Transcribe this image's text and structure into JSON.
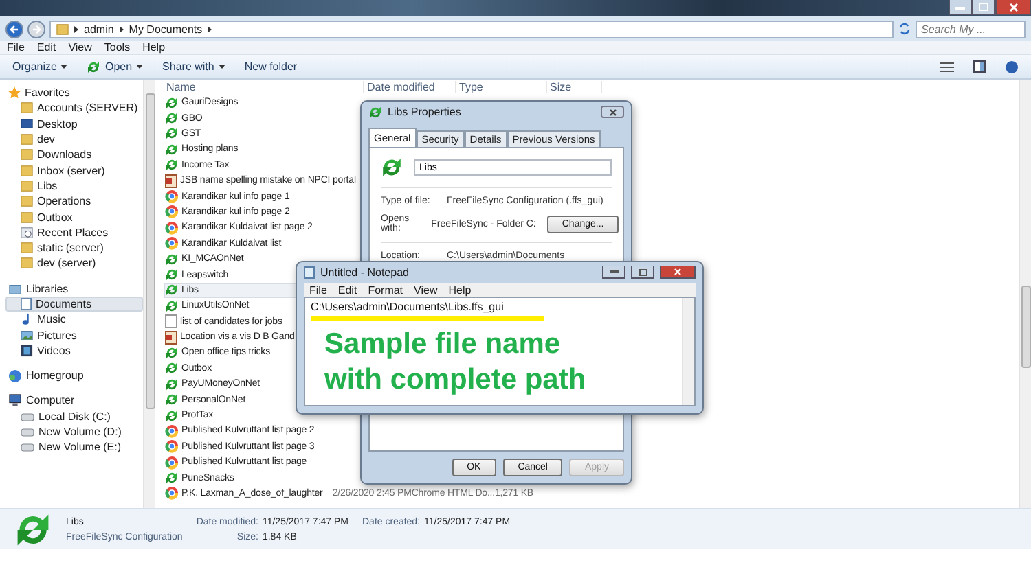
{
  "address_bar": {
    "breadcrumbs": [
      "admin",
      "My Documents"
    ],
    "search": {
      "placeholder": "Search My ..."
    }
  },
  "menu_bar": [
    "File",
    "Edit",
    "View",
    "Tools",
    "Help"
  ],
  "toolbar": [
    {
      "label": "Organize",
      "kind": "menu"
    },
    {
      "label": "Open",
      "kind": "open"
    },
    {
      "label": "Share with",
      "kind": "menu"
    },
    {
      "label": "New folder",
      "kind": "plain"
    }
  ],
  "sidebar": [
    {
      "label": "Favorites",
      "kind": "star",
      "children": [
        {
          "label": "Accounts (SERVER)",
          "kind": "folder",
          "selected": false
        },
        {
          "label": "Desktop",
          "kind": "desktop",
          "selected": false
        },
        {
          "label": "dev",
          "kind": "folder",
          "selected": false
        },
        {
          "label": "Downloads",
          "kind": "folder",
          "selected": false
        },
        {
          "label": "Inbox (server)",
          "kind": "folder",
          "selected": false
        },
        {
          "label": "Libs",
          "kind": "folder",
          "selected": false
        },
        {
          "label": "Operations",
          "kind": "folder",
          "selected": false
        },
        {
          "label": "Outbox",
          "kind": "folder",
          "selected": false
        },
        {
          "label": "Recent Places",
          "kind": "recent",
          "selected": false
        },
        {
          "label": "static (server)",
          "kind": "folder",
          "selected": false
        },
        {
          "label": "dev (server)",
          "kind": "folder",
          "selected": false
        }
      ]
    },
    {
      "label": "Libraries",
      "kind": "library",
      "children": [
        {
          "label": "Documents",
          "kind": "document",
          "selected": true
        },
        {
          "label": "Music",
          "kind": "music",
          "selected": false
        },
        {
          "label": "Pictures",
          "kind": "pictures",
          "selected": false
        },
        {
          "label": "Videos",
          "kind": "videos",
          "selected": false
        }
      ]
    },
    {
      "label": "Homegroup",
      "kind": "homegroup"
    },
    {
      "label": "Computer",
      "kind": "computer",
      "children": [
        {
          "label": "Local Disk (C:)",
          "kind": "drive",
          "selected": false
        },
        {
          "label": "New Volume (D:)",
          "kind": "drive",
          "selected": false
        },
        {
          "label": "New Volume (E:)",
          "kind": "drive",
          "selected": false
        }
      ]
    }
  ],
  "file_list": {
    "columns": [
      "Name",
      "Date modified",
      "Type",
      "Size"
    ],
    "rows": [
      {
        "name": "GauriDesigns",
        "kind": "sync",
        "selected": false
      },
      {
        "name": "GBO",
        "kind": "sync",
        "selected": false
      },
      {
        "name": "GST",
        "kind": "sync",
        "selected": false
      },
      {
        "name": "Hosting plans",
        "kind": "sync",
        "selected": false
      },
      {
        "name": "Income Tax",
        "kind": "sync",
        "selected": false
      },
      {
        "name": "JSB name spelling mistake on NPCI portal",
        "kind": "pdf",
        "selected": false
      },
      {
        "name": "Karandikar kul info page 1",
        "kind": "web",
        "selected": false
      },
      {
        "name": "Karandikar kul info page 2",
        "kind": "web",
        "selected": false
      },
      {
        "name": "Karandikar Kuldaivat list page 2",
        "kind": "web",
        "selected": false
      },
      {
        "name": "Karandikar Kuldaivat list",
        "kind": "web",
        "selected": false
      },
      {
        "name": "KI_MCAOnNet",
        "kind": "sync",
        "selected": false
      },
      {
        "name": "Leapswitch",
        "kind": "sync",
        "selected": false
      },
      {
        "name": "Libs",
        "kind": "sync",
        "selected": true
      },
      {
        "name": "LinuxUtilsOnNet",
        "kind": "sync",
        "selected": false
      },
      {
        "name": "list of candidates for jobs",
        "kind": "text",
        "selected": false
      },
      {
        "name": "Location vis a vis D B Gand",
        "kind": "pdf",
        "selected": false
      },
      {
        "name": "Open office tips tricks",
        "kind": "sync",
        "selected": false
      },
      {
        "name": "Outbox",
        "kind": "sync",
        "selected": false
      },
      {
        "name": "PayUMoneyOnNet",
        "kind": "sync",
        "selected": false
      },
      {
        "name": "PersonalOnNet",
        "kind": "sync",
        "selected": false
      },
      {
        "name": "ProfTax",
        "kind": "sync",
        "selected": false
      },
      {
        "name": "Published Kulvruttant list page 2",
        "kind": "web",
        "selected": false
      },
      {
        "name": "Published Kulvruttant list page 3",
        "kind": "web",
        "selected": false
      },
      {
        "name": "Published Kulvruttant list page",
        "kind": "web",
        "selected": false
      },
      {
        "name": "PuneSnacks",
        "kind": "sync",
        "selected": false
      },
      {
        "name": "P.K. Laxman_A_dose_of_laughter",
        "kind": "web",
        "selected": false,
        "date": "2/26/2020 2:45 PM",
        "type": "Chrome HTML Do...",
        "size": "1,271 KB"
      }
    ]
  },
  "details_pane": {
    "name": "Libs",
    "type": "FreeFileSync Configuration",
    "fields": [
      {
        "label": "Date modified:",
        "value": "11/25/2017 7:47 PM"
      },
      {
        "label": "Size:",
        "value": "1.84 KB"
      },
      {
        "label": "Date created:",
        "value": "11/25/2017 7:47 PM"
      }
    ]
  },
  "properties_dialog": {
    "title": "Libs Properties",
    "tabs": [
      {
        "label": "General",
        "selected": true
      },
      {
        "label": "Security",
        "selected": false
      },
      {
        "label": "Details",
        "selected": false
      },
      {
        "label": "Previous Versions",
        "selected": false
      }
    ],
    "name_field": "Libs",
    "type_label": "Type of file:",
    "type_value": "FreeFileSync Configuration (.ffs_gui)",
    "opens_label": "Opens with:",
    "opens_value": "FreeFileSync - Folder C:",
    "change_button": "Change...",
    "location_label": "Location:",
    "location_value": "C:\\Users\\admin\\Documents",
    "buttons": [
      {
        "label": "OK",
        "disabled": false
      },
      {
        "label": "Cancel",
        "disabled": false
      },
      {
        "label": "Apply",
        "disabled": true
      }
    ]
  },
  "notepad": {
    "title": "Untitled - Notepad",
    "menu": [
      "File",
      "Edit",
      "Format",
      "View",
      "Help"
    ],
    "text": "C:\\Users\\admin\\Documents\\Libs.ffs_gui",
    "annotation": [
      "Sample file name",
      "with complete path"
    ]
  }
}
